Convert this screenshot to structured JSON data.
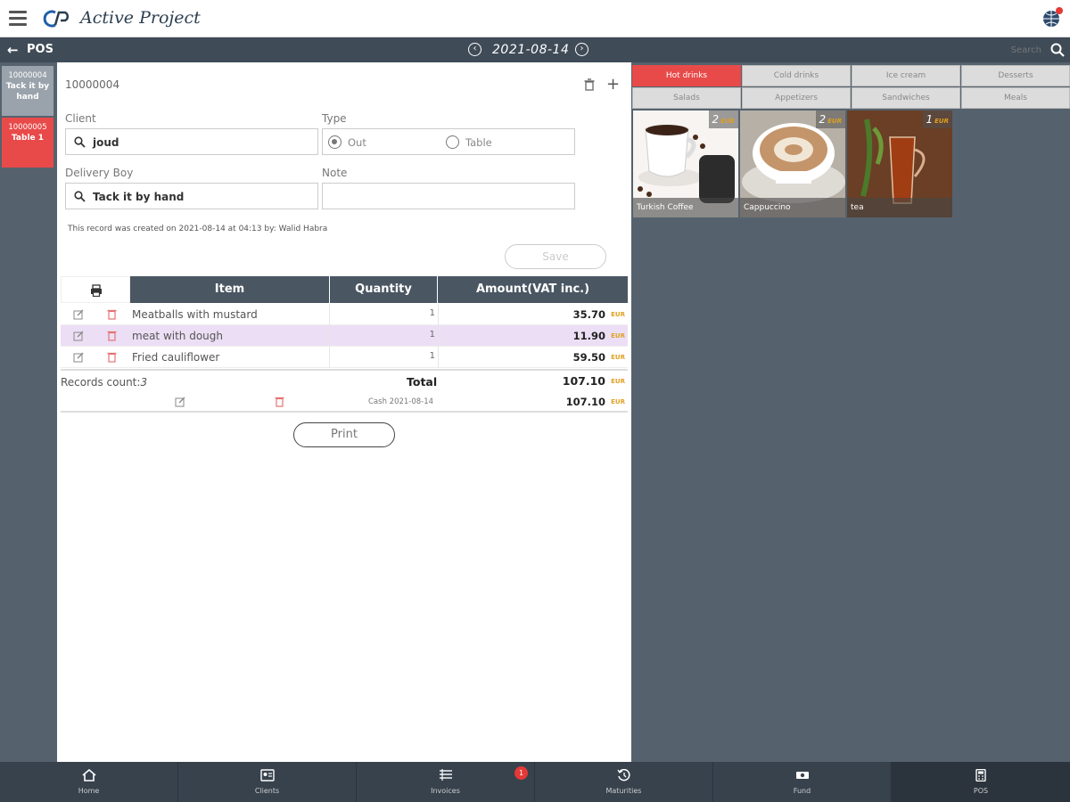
{
  "app": {
    "logo_text": "Active Project"
  },
  "navbar": {
    "title": "POS",
    "date": "2021-08-14",
    "search_placeholder": "Search"
  },
  "records": [
    {
      "number": "10000004",
      "label": "Tack it by hand"
    },
    {
      "number": "10000005",
      "label": "Table 1"
    }
  ],
  "form": {
    "record_id": "10000004",
    "client_label": "Client",
    "client_value": "joud",
    "type_label": "Type",
    "type_options": [
      "Out",
      "Table"
    ],
    "type_selected": "Out",
    "delivery_label": "Delivery Boy",
    "delivery_value": "Tack it by hand",
    "note_label": "Note",
    "note_value": "",
    "created_note": "This record was created on 2021-08-14 at 04:13 by: Walid Habra",
    "save_label": "Save"
  },
  "table": {
    "headers": [
      "Item",
      "Quantity",
      "Amount(VAT inc.)"
    ],
    "rows": [
      {
        "item": "Meatballs with mustard",
        "qty": "1",
        "amount": "35.70",
        "currency": "EUR"
      },
      {
        "item": "meat with dough",
        "qty": "1",
        "amount": "11.90",
        "currency": "EUR"
      },
      {
        "item": "Fried cauliflower",
        "qty": "1",
        "amount": "59.50",
        "currency": "EUR"
      }
    ],
    "records_count_label": "Records count:",
    "records_count": "3",
    "total_label": "Total",
    "total_amount": "107.10",
    "currency": "EUR",
    "payment_desc": "Cash 2021-08-14",
    "payment_amount": "107.10",
    "print_label": "Print"
  },
  "categories": [
    "Hot drinks",
    "Cold drinks",
    "Ice cream",
    "Desserts",
    "Salads",
    "Appetizers",
    "Sandwiches",
    "Meals"
  ],
  "active_category": "Hot drinks",
  "products": [
    {
      "name": "Turkish Coffee",
      "price": "2",
      "currency": "EUR"
    },
    {
      "name": "Cappuccino",
      "price": "2",
      "currency": "EUR"
    },
    {
      "name": "tea",
      "price": "1",
      "currency": "EUR"
    }
  ],
  "bottom_nav": [
    {
      "label": "Home",
      "icon": "home-icon"
    },
    {
      "label": "Clients",
      "icon": "clients-icon"
    },
    {
      "label": "Invoices",
      "icon": "invoices-icon",
      "badge": "1"
    },
    {
      "label": "Maturities",
      "icon": "maturities-icon"
    },
    {
      "label": "Fund",
      "icon": "fund-icon"
    },
    {
      "label": "POS",
      "icon": "pos-icon",
      "active": true
    }
  ],
  "colors": {
    "accent": "#e84a4a",
    "header_dark": "#3f4b57",
    "panel_bg": "#55626e",
    "currency": "#e0a020"
  }
}
